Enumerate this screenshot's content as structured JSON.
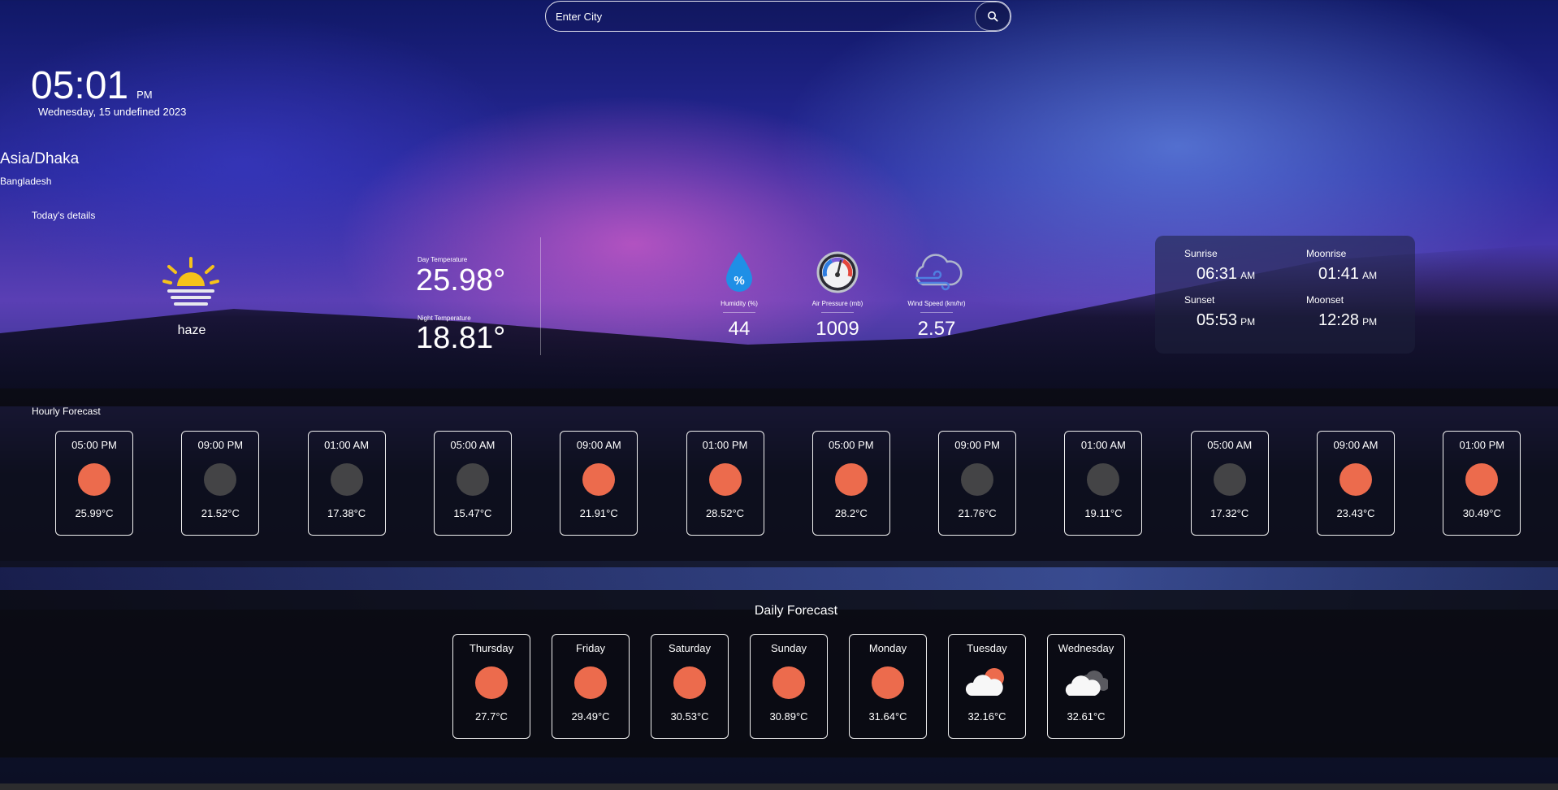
{
  "search": {
    "placeholder": "Enter City"
  },
  "clock": {
    "time": "05:01",
    "ampm": "PM",
    "date": "Wednesday, 15 undefined 2023"
  },
  "location": {
    "timezone": "Asia/Dhaka",
    "country": "Bangladesh"
  },
  "today": {
    "section_title": "Today's details",
    "condition": "haze",
    "condition_icon": "haze-sun-icon",
    "day_temp_label": "Day Temperature",
    "day_temp": "25.98°",
    "night_temp_label": "Night Temperature",
    "night_temp": "18.81°",
    "metrics": [
      {
        "label": "Humidity (%)",
        "value": "44",
        "icon": "humidity-drop-icon"
      },
      {
        "label": "Air Pressure (mb)",
        "value": "1009",
        "icon": "pressure-gauge-icon"
      },
      {
        "label": "Wind Speed (km/hr)",
        "value": "2.57",
        "icon": "wind-cloud-icon"
      }
    ],
    "astro": {
      "sunrise_label": "Sunrise",
      "sunrise": "06:31",
      "sunrise_ampm": "AM",
      "moonrise_label": "Moonrise",
      "moonrise": "01:41",
      "moonrise_ampm": "AM",
      "sunset_label": "Sunset",
      "sunset": "05:53",
      "sunset_ampm": "PM",
      "moonset_label": "Moonset",
      "moonset": "12:28",
      "moonset_ampm": "PM"
    }
  },
  "hourly": {
    "title": "Hourly Forecast",
    "items": [
      {
        "time": "05:00 PM",
        "temp": "25.99°C",
        "icon": "sun"
      },
      {
        "time": "09:00 PM",
        "temp": "21.52°C",
        "icon": "night"
      },
      {
        "time": "01:00 AM",
        "temp": "17.38°C",
        "icon": "night"
      },
      {
        "time": "05:00 AM",
        "temp": "15.47°C",
        "icon": "night"
      },
      {
        "time": "09:00 AM",
        "temp": "21.91°C",
        "icon": "sun"
      },
      {
        "time": "01:00 PM",
        "temp": "28.52°C",
        "icon": "sun"
      },
      {
        "time": "05:00 PM",
        "temp": "28.2°C",
        "icon": "sun"
      },
      {
        "time": "09:00 PM",
        "temp": "21.76°C",
        "icon": "night"
      },
      {
        "time": "01:00 AM",
        "temp": "19.11°C",
        "icon": "night"
      },
      {
        "time": "05:00 AM",
        "temp": "17.32°C",
        "icon": "night"
      },
      {
        "time": "09:00 AM",
        "temp": "23.43°C",
        "icon": "sun"
      },
      {
        "time": "01:00 PM",
        "temp": "30.49°C",
        "icon": "sun"
      }
    ]
  },
  "daily": {
    "title": "Daily Forecast",
    "items": [
      {
        "day": "Thursday",
        "temp": "27.7°C",
        "icon": "sun"
      },
      {
        "day": "Friday",
        "temp": "29.49°C",
        "icon": "sun"
      },
      {
        "day": "Saturday",
        "temp": "30.53°C",
        "icon": "sun"
      },
      {
        "day": "Sunday",
        "temp": "30.89°C",
        "icon": "sun"
      },
      {
        "day": "Monday",
        "temp": "31.64°C",
        "icon": "sun"
      },
      {
        "day": "Tuesday",
        "temp": "32.16°C",
        "icon": "cloud-sun"
      },
      {
        "day": "Wednesday",
        "temp": "32.61°C",
        "icon": "clouds"
      }
    ]
  },
  "colors": {
    "sun_orb": "#ec6b4d",
    "night_orb": "#444446",
    "haze_sun": "#f5c21b"
  }
}
